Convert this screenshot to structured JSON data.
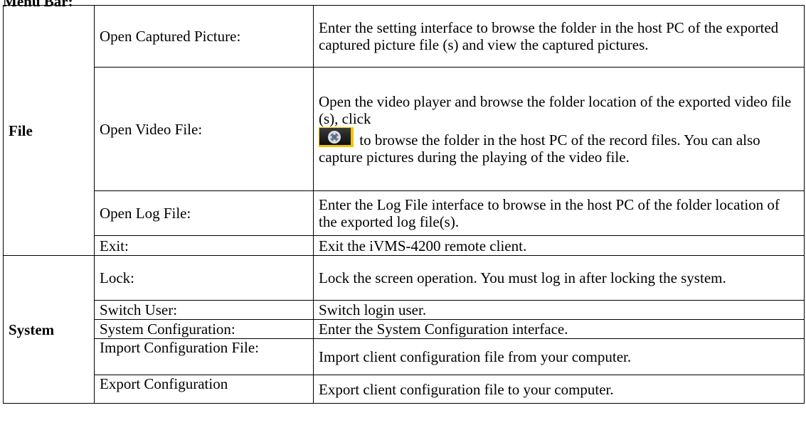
{
  "heading": "Menu Bar:",
  "groups": [
    {
      "category": "File",
      "rows": [
        {
          "item": "Open Captured Picture:",
          "desc": "Enter the setting interface to browse the folder in the host PC of the exported captured picture file (s) and view the captured pictures."
        },
        {
          "item": "Open Video File:",
          "desc_part1": "Open the video player and browse the folder location of the exported video file (s), click",
          "desc_part2": " to browse the folder in the host PC of the record files. You can also capture pictures during the playing of the video file.",
          "icon": "video-folder-icon"
        },
        {
          "item": "Open Log File:",
          "desc": "Enter the Log File interface to browse in the host PC of the folder location of the exported log file(s)."
        },
        {
          "item": "Exit:",
          "desc": "Exit the iVMS-4200 remote client."
        }
      ]
    },
    {
      "category": "System",
      "rows": [
        {
          "item": "Lock:",
          "desc": "Lock the screen operation. You must log in after locking the system."
        },
        {
          "item": "Switch User:",
          "desc": "Switch login user."
        },
        {
          "item": "System Configuration:",
          "desc": "Enter the System Configuration interface."
        },
        {
          "item": "Import Configuration File:",
          "desc": "Import client configuration file from your computer."
        },
        {
          "item": "Export Configuration",
          "desc": "Export client configuration file to your computer."
        }
      ]
    }
  ]
}
